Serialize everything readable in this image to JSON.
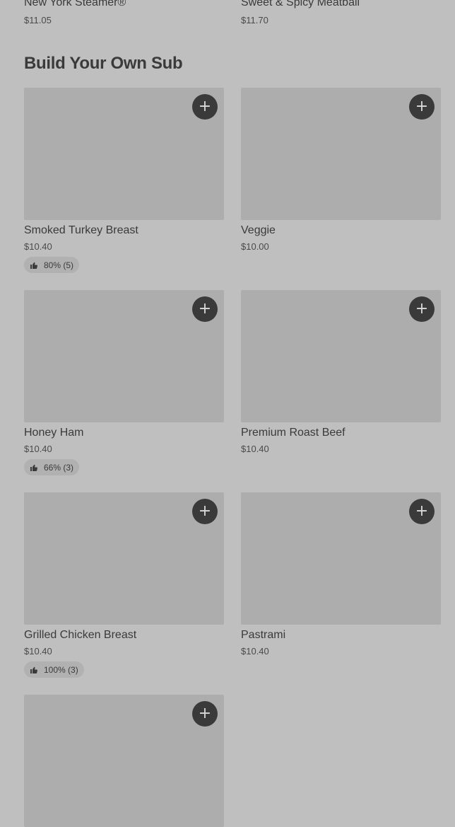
{
  "top_items": [
    {
      "name": "New York Steamer®",
      "price": "$11.05"
    },
    {
      "name": "Sweet & Spicy Meatball",
      "price": "$11.70"
    }
  ],
  "section": {
    "title": "Build Your Own Sub"
  },
  "add_icon": "plus-icon",
  "items": [
    {
      "name": "Smoked Turkey Breast",
      "price": "$10.40",
      "rating": "80% (5)"
    },
    {
      "name": "Veggie",
      "price": "$10.00",
      "rating": ""
    },
    {
      "name": "Honey Ham",
      "price": "$10.40",
      "rating": "66% (3)"
    },
    {
      "name": "Premium Roast Beef",
      "price": "$10.40",
      "rating": ""
    },
    {
      "name": "Grilled Chicken Breast",
      "price": "$10.40",
      "rating": "100% (3)"
    },
    {
      "name": "Pastrami",
      "price": "$10.40",
      "rating": ""
    },
    {
      "name": "",
      "price": "",
      "rating": ""
    }
  ]
}
